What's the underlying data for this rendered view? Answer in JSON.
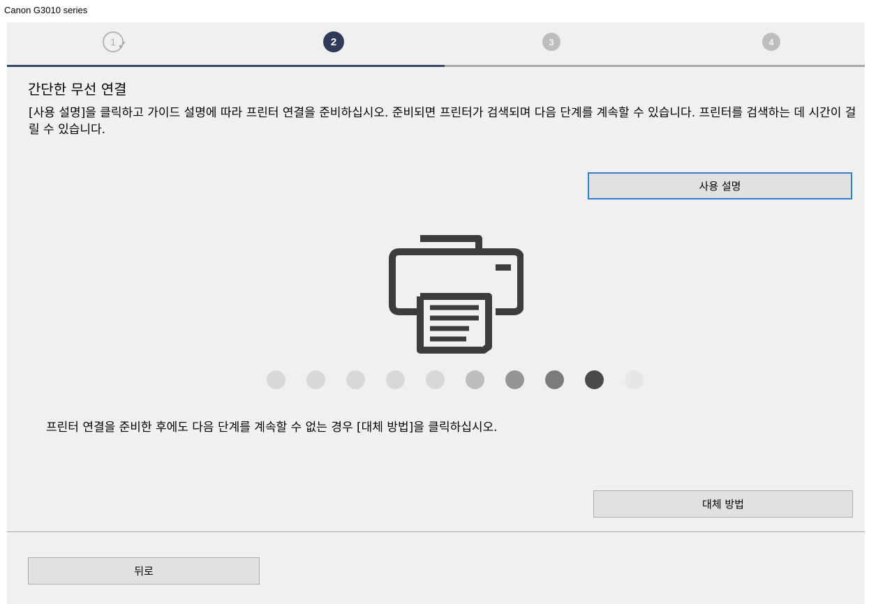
{
  "window": {
    "title": "Canon G3010 series"
  },
  "steps": [
    {
      "label": "1",
      "state": "done"
    },
    {
      "label": "2",
      "state": "current"
    },
    {
      "label": "3",
      "state": "future"
    },
    {
      "label": "4",
      "state": "future"
    }
  ],
  "progress_fraction": 0.51,
  "main": {
    "heading": "간단한 무선 연결",
    "description": "[사용 설명]을 클릭하고 가이드 설명에 따라 프린터 연결을 준비하십시오. 준비되면 프린터가 검색되며 다음 단계를 계속할 수 있습니다. 프린터를 검색하는 데 시간이 걸릴 수 있습니다.",
    "guide_button": "사용 설명",
    "note": "프린터 연결을 준비한 후에도 다음 단계를 계속할 수 없는 경우 [대체 방법]을 클릭하십시오.",
    "alt_button": "대체 방법"
  },
  "footer": {
    "back_button": "뒤로"
  },
  "icons": {
    "printer": "printer-icon",
    "step_done": "check-icon"
  },
  "colors": {
    "accent": "#303b5a",
    "focus": "#2f7fd0",
    "dots": [
      "#d8d8d8",
      "#d8d8d8",
      "#d8d8d8",
      "#d8d8d8",
      "#d8d8d8",
      "#bdbdbd",
      "#959595",
      "#7b7b7b",
      "#4a4a4a",
      "#e6e6e6"
    ]
  }
}
